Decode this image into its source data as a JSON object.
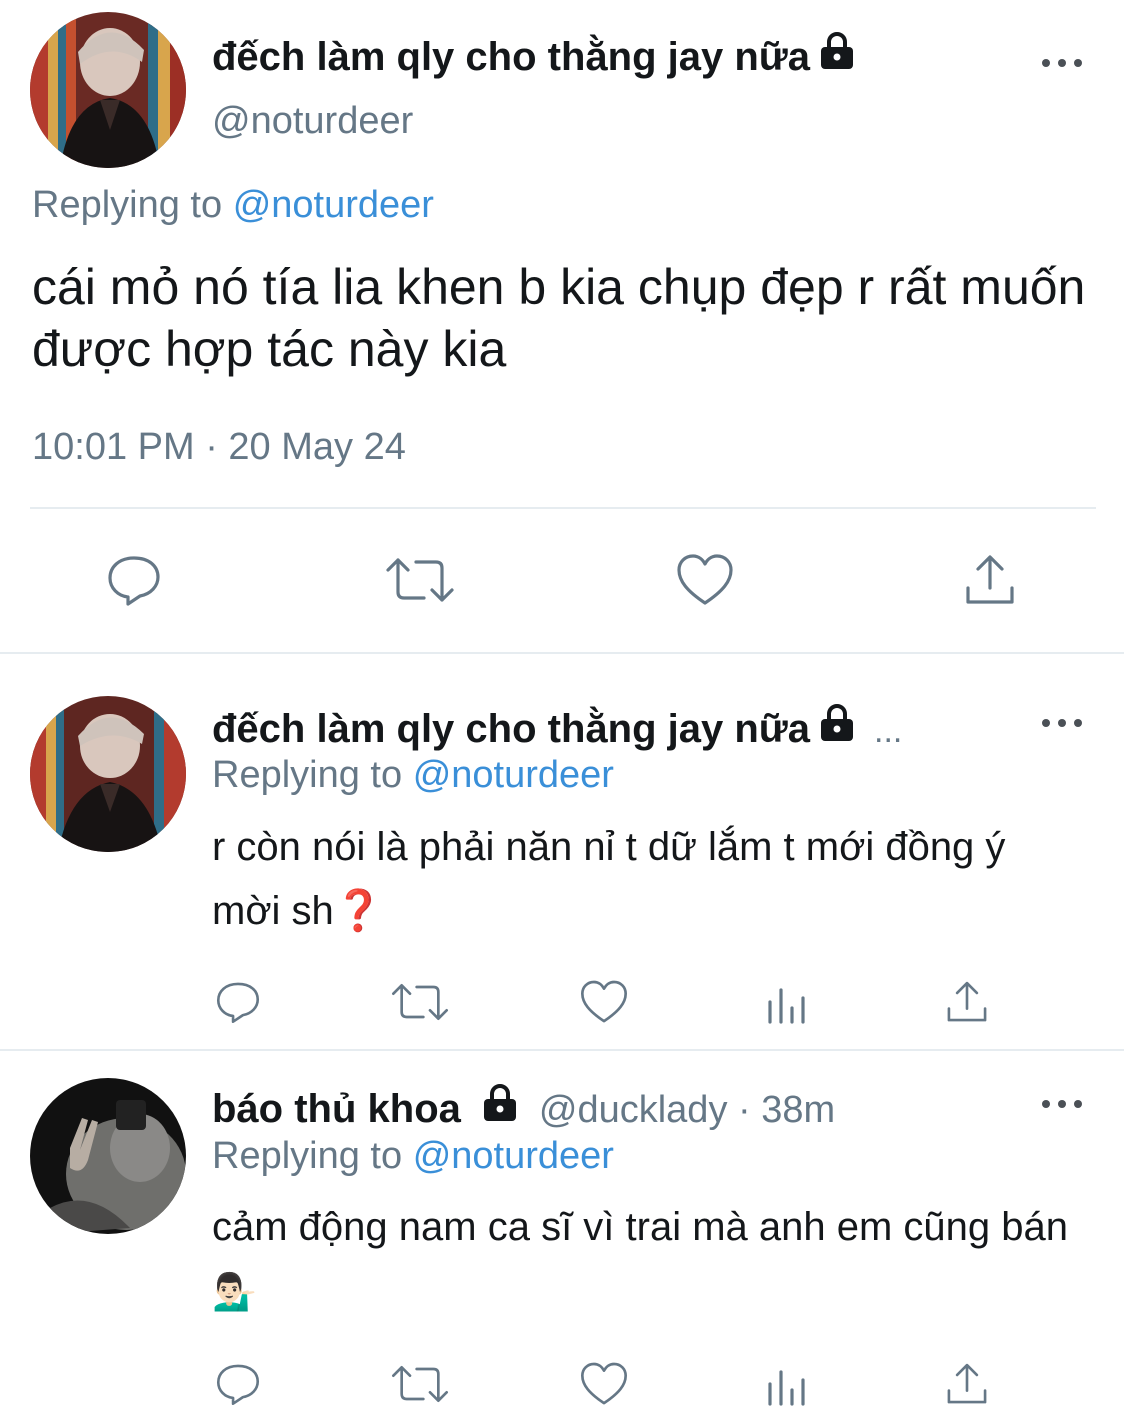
{
  "main_tweet": {
    "display_name": "đếch làm qly cho thằng jay nữa",
    "handle": "@noturdeer",
    "replying_prefix": "Replying to",
    "replying_to": "@noturdeer",
    "text": "cái mỏ nó tía lia khen b kia chụp đẹp r rất muốn được hợp tác này kia",
    "timestamp": "10:01 PM · 20 May 24"
  },
  "replies": [
    {
      "display_name": "đếch làm qly cho thằng jay nữa",
      "truncation": "...",
      "replying_prefix": "Replying to",
      "replying_to": "@noturdeer",
      "text": "r còn nói là phải năn nỉ t dữ lắm t mới đồng ý mời sh",
      "emoji": "❓"
    },
    {
      "display_name": "báo thủ khoa",
      "handle_time": "@ducklady · 38m",
      "replying_prefix": "Replying to",
      "replying_to": "@noturdeer",
      "text": "cảm động nam ca sĩ vì trai mà anh em cũng bán",
      "emoji": "💁🏻‍♂️"
    }
  ],
  "icons": [
    "reply-icon",
    "retweet-icon",
    "like-icon",
    "share-icon",
    "analytics-icon",
    "lock-icon",
    "more-icon"
  ],
  "colors": {
    "link": "#3a8fd8",
    "muted": "#657786",
    "text": "#14171a",
    "divider": "#e6ecf0"
  }
}
